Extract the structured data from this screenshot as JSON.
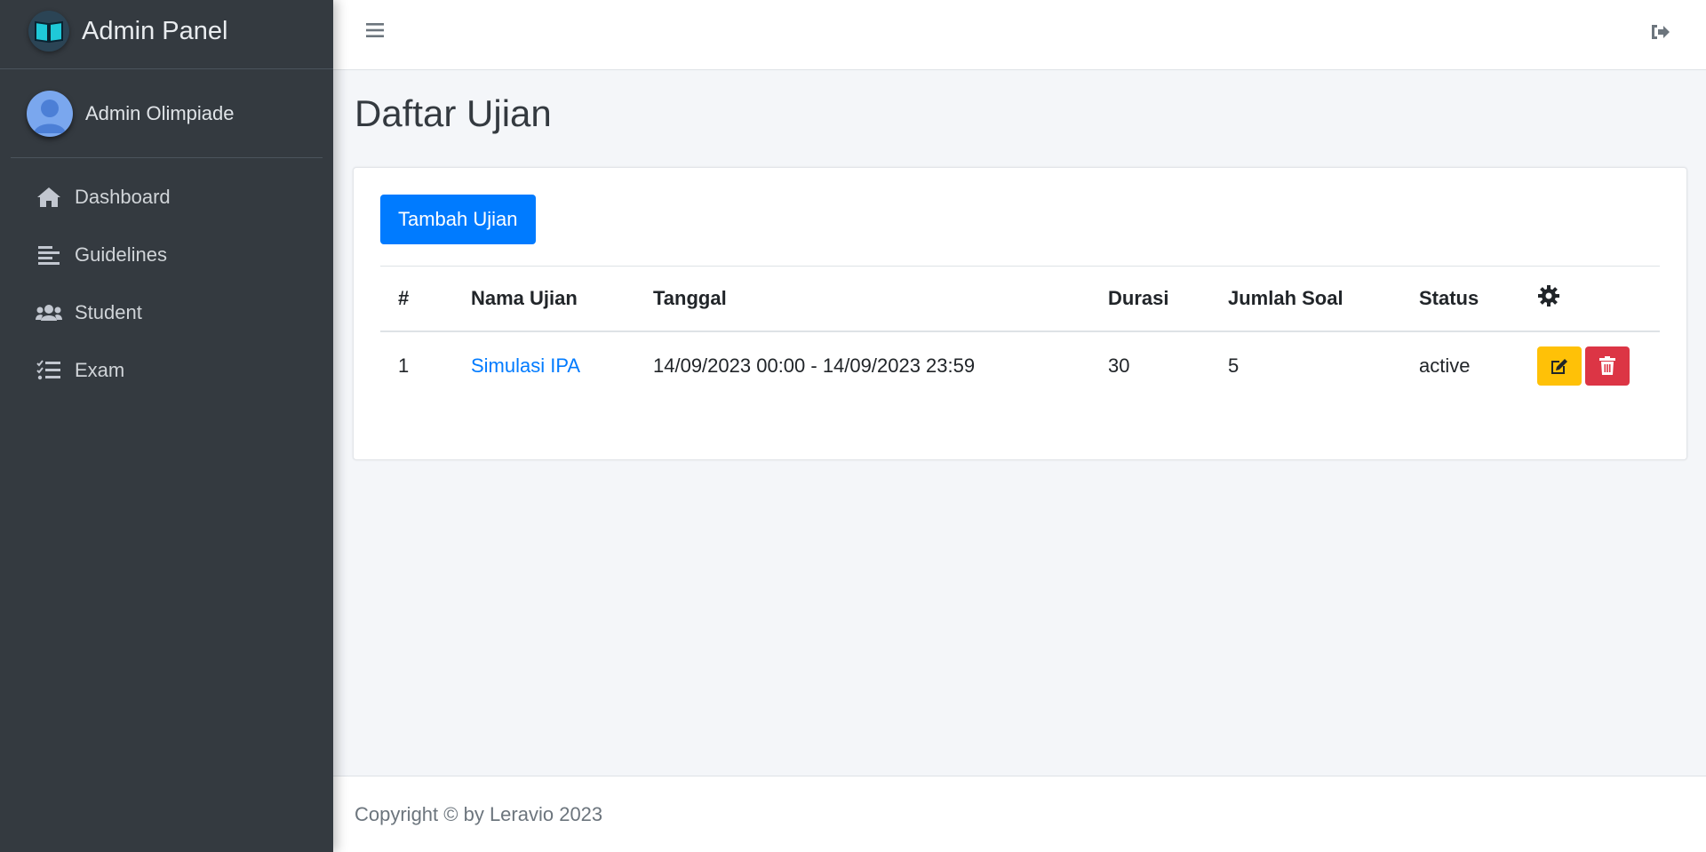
{
  "brand": {
    "title": "Admin Panel"
  },
  "user": {
    "name": "Admin Olimpiade"
  },
  "sidebar": {
    "items": [
      {
        "label": "Dashboard",
        "icon": "home-icon"
      },
      {
        "label": "Guidelines",
        "icon": "align-left-icon"
      },
      {
        "label": "Student",
        "icon": "users-icon"
      },
      {
        "label": "Exam",
        "icon": "tasks-icon"
      }
    ]
  },
  "page": {
    "title": "Daftar Ujian"
  },
  "toolbar": {
    "add_label": "Tambah Ujian"
  },
  "table": {
    "headers": [
      "#",
      "Nama Ujian",
      "Tanggal",
      "Durasi",
      "Jumlah Soal",
      "Status"
    ],
    "settings_icon": "gear-icon",
    "rows": [
      {
        "no": "1",
        "name": "Simulasi IPA",
        "date": "14/09/2023 00:00 - 14/09/2023 23:59",
        "duration": "30",
        "questions": "5",
        "status": "active"
      }
    ]
  },
  "footer": {
    "text": "Copyright © by Leravio 2023"
  },
  "colors": {
    "primary": "#007bff",
    "warning": "#ffc107",
    "danger": "#dc3545",
    "sidebar": "#343a40"
  }
}
